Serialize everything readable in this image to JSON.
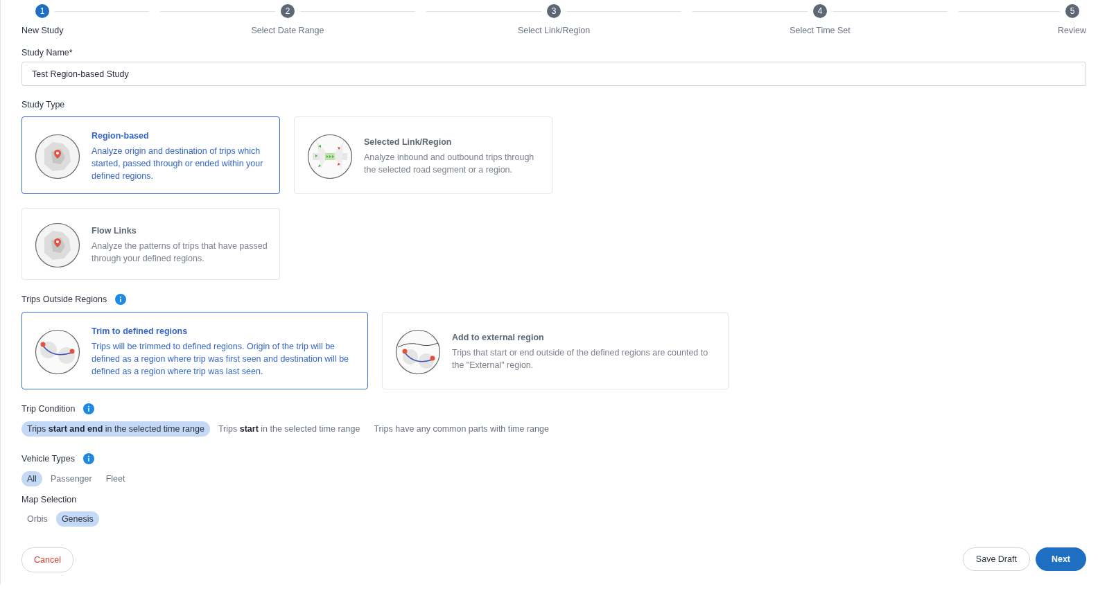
{
  "stepper": [
    {
      "number": "1",
      "label": "New Study",
      "selected": true
    },
    {
      "number": "2",
      "label": "Select Date Range",
      "selected": false
    },
    {
      "number": "3",
      "label": "Select Link/Region",
      "selected": false
    },
    {
      "number": "4",
      "label": "Select Time Set",
      "selected": false
    },
    {
      "number": "5",
      "label": "Review",
      "selected": false
    }
  ],
  "study_name": {
    "label": "Study Name*",
    "value": "Test Region-based Study"
  },
  "study_type": {
    "label": "Study Type",
    "options": [
      {
        "kind": "region",
        "title": "Region-based",
        "description": "Analyze origin and destination of trips which started, passed through or ended within your defined regions.",
        "selected": true
      },
      {
        "kind": "link",
        "title": "Selected Link/Region",
        "description": "Analyze inbound and outbound trips through the selected road segment or a region.",
        "selected": false
      },
      {
        "kind": "region",
        "title": "Flow Links",
        "description": "Analyze the patterns of trips that have passed through your defined regions.",
        "selected": false
      }
    ]
  },
  "trips_outside_regions": {
    "label": "Trips Outside Regions",
    "options": [
      {
        "kind": "trim",
        "title": "Trim to defined regions",
        "description": "Trips will be trimmed to defined regions. Origin of the trip will be defined as a region where trip was first seen and destination will be defined as a region where trip was last seen.",
        "selected": true
      },
      {
        "kind": "external",
        "title": "Add to external region",
        "description": "Trips that start or end outside of the defined regions are counted to the \"External\" region.",
        "selected": false
      }
    ]
  },
  "trip_condition": {
    "label": "Trip Condition",
    "options": [
      {
        "label": "Trips **start and end** in the selected time range",
        "selected": true
      },
      {
        "label": "Trips **start** in the selected time range",
        "selected": false
      },
      {
        "label": "Trips have any common parts with time range",
        "selected": false
      }
    ]
  },
  "vehicle_types": {
    "label": "Vehicle Types",
    "options": [
      {
        "label": "All",
        "selected": true
      },
      {
        "label": "Passenger",
        "selected": false
      },
      {
        "label": "Fleet",
        "selected": false
      }
    ]
  },
  "map_selection": {
    "label": "Map Selection",
    "options": [
      {
        "label": "Orbis",
        "selected": false
      },
      {
        "label": "Genesis",
        "selected": true
      }
    ]
  },
  "buttons": {
    "cancel": "Cancel",
    "save_draft": "Save Draft",
    "next": "Next"
  }
}
